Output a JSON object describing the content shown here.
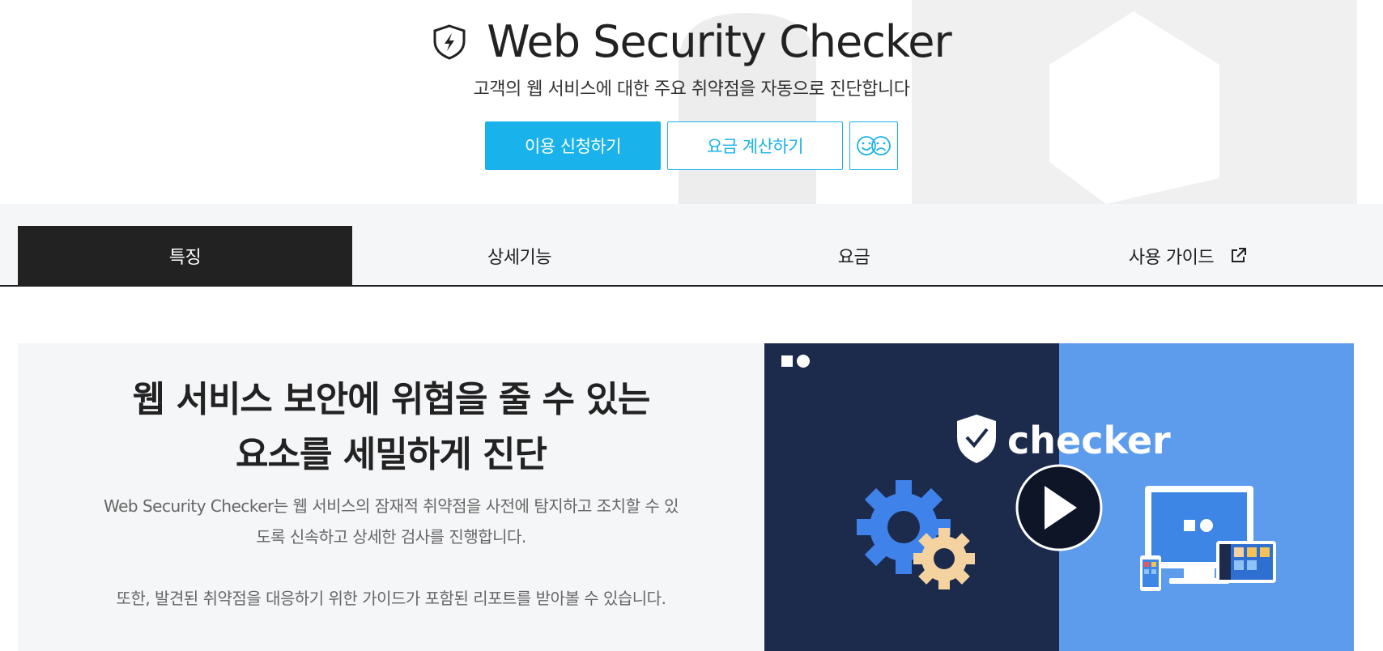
{
  "hero": {
    "title": "Web Security Checker",
    "subtitle": "고객의 웹 서비스에 대한 주요 취약점을 자동으로 진단합니다",
    "apply_button": "이용 신청하기",
    "pricing_button": "요금 계산하기",
    "icon": "shield-lightning-icon",
    "feedback_icon": "smile-frown-icon"
  },
  "tabs": [
    {
      "label": "특징",
      "active": true
    },
    {
      "label": "상세기능",
      "active": false
    },
    {
      "label": "요금",
      "active": false
    },
    {
      "label": "사용 가이드",
      "active": false,
      "icon": "external-link-icon"
    }
  ],
  "feature": {
    "heading_line1": "웹 서비스 보안에 위협을 줄 수 있는",
    "heading_line2": "요소를 세밀하게 진단",
    "desc1": "Web Security Checker는 웹 서비스의 잠재적 취약점을 사전에 탐지하고 조치할 수 있도록 신속하고 상세한 검사를 진행합니다.",
    "desc2": "또한, 발견된 취약점을 대응하기 위한 가이드가 포함된 리포트를 받아볼 수 있습니다."
  },
  "video": {
    "brand": "checker",
    "icon": "play-icon"
  },
  "colors": {
    "accent": "#1ab2ea",
    "dark": "#222222",
    "navy": "#1c2b4b",
    "light_blue": "#5d9bec"
  }
}
